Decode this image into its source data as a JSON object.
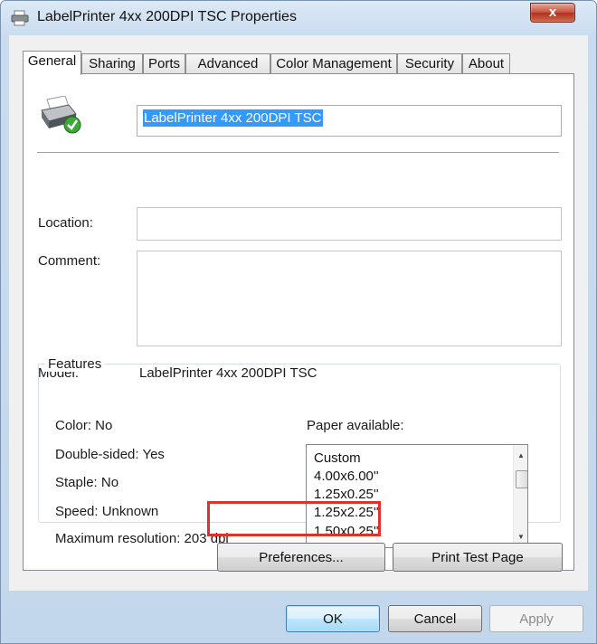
{
  "window": {
    "title": "LabelPrinter 4xx 200DPI TSC Properties",
    "close_label": "x"
  },
  "tabs": [
    {
      "label": "General",
      "active": true
    },
    {
      "label": "Sharing"
    },
    {
      "label": "Ports"
    },
    {
      "label": "Advanced"
    },
    {
      "label": "Color Management"
    },
    {
      "label": "Security"
    },
    {
      "label": "About"
    }
  ],
  "general": {
    "printer_name": "LabelPrinter 4xx 200DPI TSC",
    "location_label": "Location:",
    "location_value": "",
    "comment_label": "Comment:",
    "comment_value": "",
    "model_label": "Model:",
    "model_value": "LabelPrinter 4xx 200DPI TSC"
  },
  "features": {
    "title": "Features",
    "color": "Color: No",
    "double_sided": "Double-sided: Yes",
    "staple": "Staple: No",
    "speed": "Speed: Unknown",
    "max_resolution": "Maximum resolution: 203 dpi",
    "paper_label": "Paper available:",
    "paper_items": [
      "Custom",
      "4.00x6.00''",
      "1.25x0.25''",
      "1.25x2.25''",
      "1.50x0.25''"
    ]
  },
  "buttons": {
    "preferences": "Preferences...",
    "print_test_page": "Print Test Page",
    "ok": "OK",
    "cancel": "Cancel",
    "apply": "Apply"
  },
  "colors": {
    "highlight": "#e0312a",
    "selection": "#3399ff"
  }
}
